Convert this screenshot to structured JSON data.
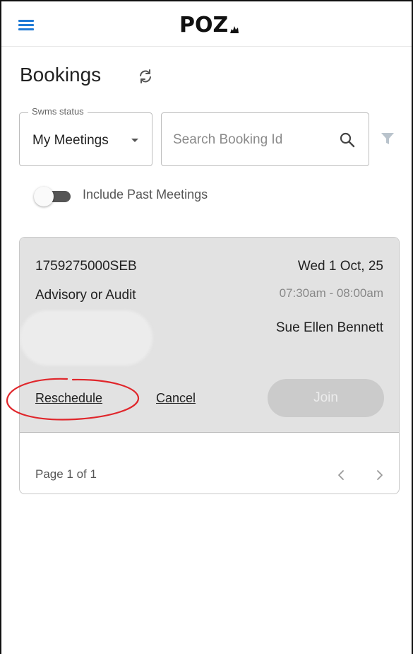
{
  "app": {
    "logo_text": "POZ"
  },
  "header": {
    "title": "Bookings"
  },
  "filters": {
    "status_label": "Swms status",
    "status_value": "My Meetings",
    "search_placeholder": "Search Booking Id",
    "include_past_label": "Include Past Meetings",
    "include_past_enabled": false
  },
  "booking": {
    "id": "1759275000SEB",
    "type": "Advisory or Audit",
    "date": "Wed 1 Oct, 25",
    "time": "07:30am - 08:00am",
    "host": "Sue Ellen Bennett",
    "reschedule_label": "Reschedule",
    "cancel_label": "Cancel",
    "join_label": "Join"
  },
  "pagination": {
    "text": "Page 1 of 1"
  },
  "colors": {
    "accent": "#1f7ad6",
    "card_bg": "#e2e2e2",
    "annotation": "#e0262b"
  },
  "icons": [
    "menu-icon",
    "refresh-icon",
    "search-icon",
    "filter-icon",
    "chevron-left-icon",
    "chevron-right-icon"
  ]
}
